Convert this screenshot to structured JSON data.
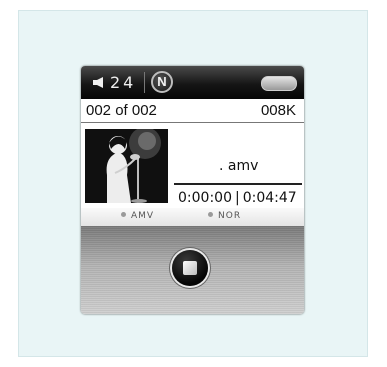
{
  "status_bar": {
    "volume_icon": "speaker-icon",
    "volume_level": "24",
    "mode_icon": "nor-mode-icon",
    "mode_label": "N",
    "battery_icon": "battery-icon"
  },
  "track": {
    "index_label": "002 of 002",
    "size_label": "008K"
  },
  "now_playing": {
    "album_art": "album-art-image",
    "file_name": ". amv",
    "elapsed": "0:00:00",
    "time_separator": "|",
    "total": "0:04:47"
  },
  "info": {
    "format_label": "AMV",
    "eq_label": "NOR"
  },
  "controls": {
    "stop_icon": "stop-icon"
  }
}
